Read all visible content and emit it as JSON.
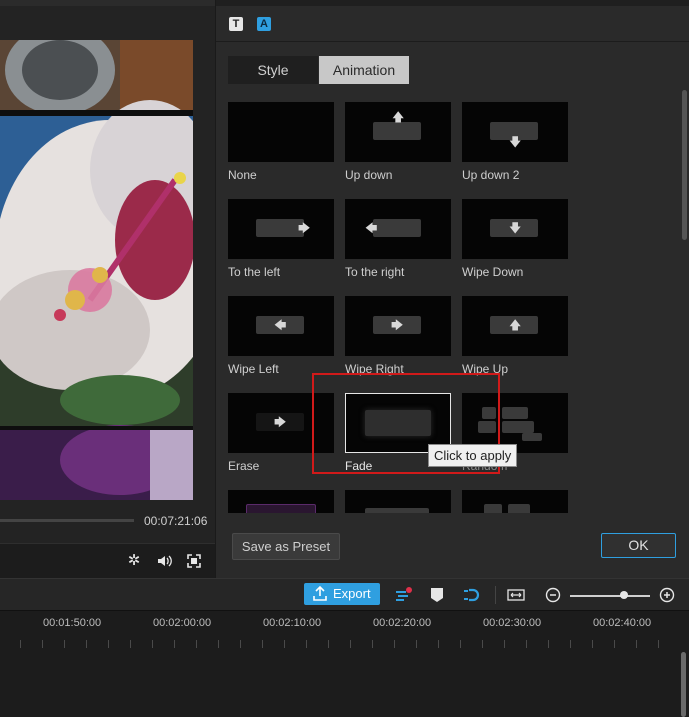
{
  "preview": {
    "time": "00:07:21:06"
  },
  "panel": {
    "tabs": [
      {
        "label": "Style",
        "active": false
      },
      {
        "label": "Animation",
        "active": true
      }
    ],
    "animations": [
      {
        "label": "None",
        "icon": "none"
      },
      {
        "label": "Up down",
        "icon": "arrow-up"
      },
      {
        "label": "Up down 2",
        "icon": "arrow-down"
      },
      {
        "label": "To the left",
        "icon": "arrow-right"
      },
      {
        "label": "To the right",
        "icon": "arrow-left"
      },
      {
        "label": "Wipe Down",
        "icon": "arrow-down"
      },
      {
        "label": "Wipe Left",
        "icon": "arrow-left"
      },
      {
        "label": "Wipe Right",
        "icon": "arrow-right"
      },
      {
        "label": "Wipe Up",
        "icon": "arrow-up"
      },
      {
        "label": "Erase",
        "icon": "arrow-right"
      },
      {
        "label": "Fade",
        "icon": "fade"
      },
      {
        "label": "Random",
        "icon": "random"
      }
    ],
    "selected": "Fade",
    "tooltip": "Click to apply",
    "save_preset": "Save as Preset",
    "ok": "OK"
  },
  "timeline": {
    "export_label": "Export",
    "ruler": [
      "00:01:50:00",
      "00:02:00:00",
      "00:02:10:00",
      "00:02:20:00",
      "00:02:30:00",
      "00:02:40:00"
    ]
  },
  "colors": {
    "accent": "#2f9fe0",
    "highlight": "#d11a1a"
  }
}
